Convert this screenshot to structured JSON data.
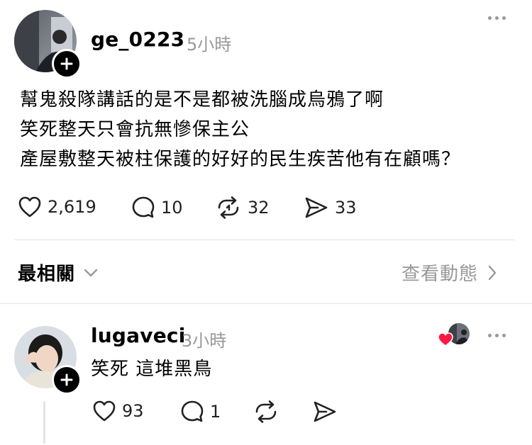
{
  "post": {
    "username": "ge_0223",
    "time": "5小時",
    "lines": [
      "幫鬼殺隊講話的是不是都被洗腦成烏鴉了啊",
      "笑死整天只會抗無慘保主公",
      "產屋敷整天被柱保護的好好的民生疾苦他有在顧嗎？"
    ],
    "likes": "2,619",
    "comments": "10",
    "reposts": "32",
    "shares": "33"
  },
  "sort_bar": {
    "sort_label": "最相關",
    "activity_label": "查看動態"
  },
  "reply": {
    "username": "lugaveci",
    "time": "3小時",
    "text": "笑死 這堆黑鳥",
    "likes": "93",
    "comments": "1"
  },
  "icons": {
    "more": "more-horizontal-icon",
    "like": "heart-icon",
    "comment": "comment-bubble-icon",
    "repost": "repost-icon",
    "share": "send-icon",
    "follow": "plus-icon",
    "chevron": "chevron-icon"
  },
  "colors": {
    "timestamp": "#999999",
    "heart_liked": "#ff1744",
    "divider": "#e6e6e6"
  }
}
